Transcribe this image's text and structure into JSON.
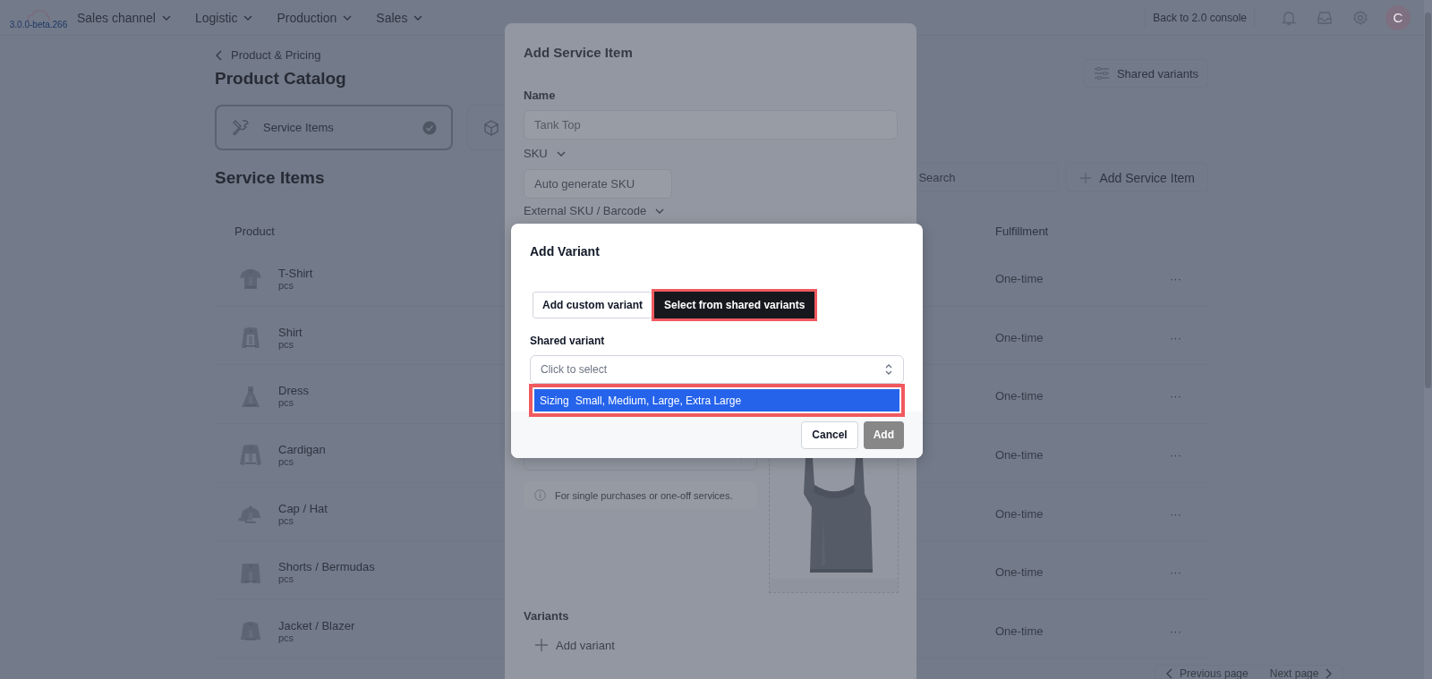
{
  "nav": {
    "version": "3.0.0-beta.266",
    "menus": [
      "Sales channel",
      "Logistic",
      "Production",
      "Sales"
    ],
    "back_button": "Back to 2.0 console",
    "avatar": "C"
  },
  "page": {
    "breadcrumb": "Product & Pricing",
    "title": "Product Catalog",
    "catalog_tabs": [
      {
        "label": "Service Items",
        "selected": true,
        "kind": "tools"
      },
      {
        "selected": false,
        "kind": "cube"
      }
    ],
    "shared_variants_button": "Shared variants",
    "section_title": "Service Items",
    "search": {
      "placeholder": "Search"
    },
    "add_button": "Add Service Item",
    "table": {
      "columns": [
        "Product",
        "Fulfillment"
      ],
      "rows": [
        {
          "name": "T-Shirt",
          "unit": "pcs",
          "fulfillment": "One-time",
          "actions": "···"
        },
        {
          "name": "Shirt",
          "unit": "pcs",
          "fulfillment": "One-time",
          "actions": "···"
        },
        {
          "name": "Dress",
          "unit": "pcs",
          "fulfillment": "One-time",
          "actions": "···"
        },
        {
          "name": "Cardigan",
          "unit": "pcs",
          "fulfillment": "One-time",
          "actions": "···"
        },
        {
          "name": "Cap / Hat",
          "unit": "pcs",
          "fulfillment": "One-time",
          "actions": "···"
        },
        {
          "name": "Shorts / Bermudas",
          "unit": "pcs",
          "fulfillment": "One-time",
          "actions": "···"
        },
        {
          "name": "Jacket / Blazer",
          "unit": "pcs",
          "fulfillment": "One-time",
          "actions": "···"
        }
      ]
    },
    "pagination": {
      "previous": "Previous page",
      "next": "Next page"
    }
  },
  "drawer": {
    "title": "Add Service Item",
    "name_label": "Name",
    "name_value": "Tank Top",
    "sku_label": "SKU",
    "sku": {
      "placeholder": "Auto generate SKU"
    },
    "barcode_label": "External SKU / Barcode",
    "hint": "For single purchases or one-off services.",
    "variants_label": "Variants",
    "add_variant": "Add variant"
  },
  "dialog": {
    "title": "Add Variant",
    "modes": [
      {
        "label": "Add custom variant",
        "selected": false,
        "highlighted": false
      },
      {
        "label": "Select from shared variants",
        "selected": true,
        "highlighted": true
      }
    ],
    "field_label": "Shared variant",
    "select": {
      "placeholder": "Click to select"
    },
    "options": [
      {
        "name": "Sizing",
        "values": "Small, Medium, Large, Extra Large",
        "selected": true,
        "highlighted": true
      }
    ],
    "buttons": [
      {
        "label": "Cancel",
        "kind": "secondary",
        "disabled": false
      },
      {
        "label": "Add",
        "kind": "primary",
        "disabled": true
      }
    ]
  }
}
